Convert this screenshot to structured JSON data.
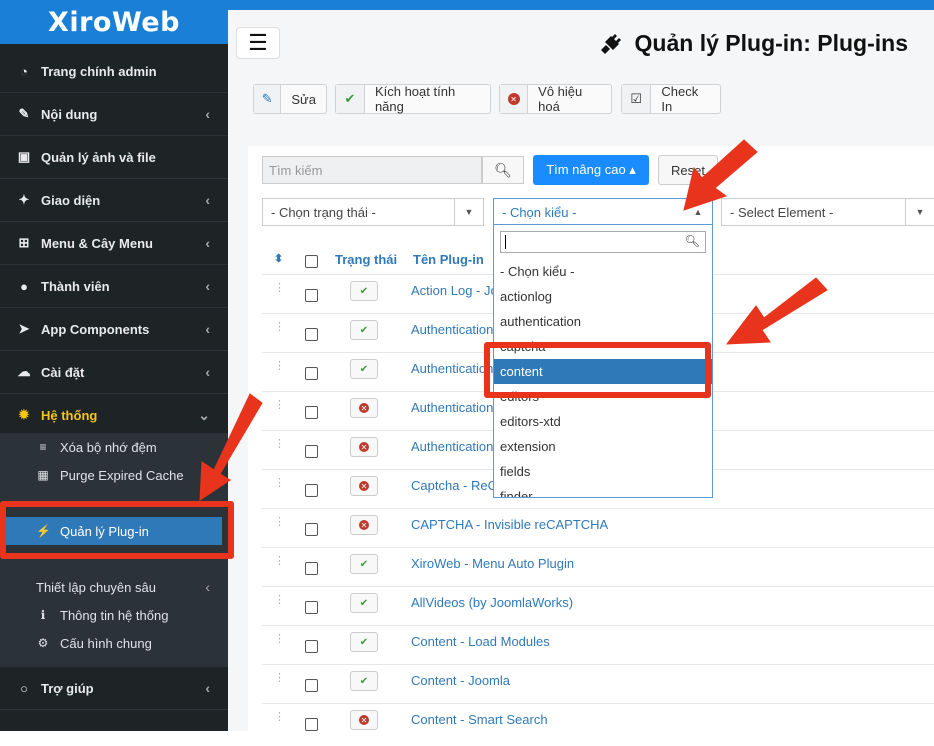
{
  "brand": {
    "logo_text": "XiroWeb",
    "accent": "#1a7fd6"
  },
  "sidebar": {
    "items": [
      {
        "label": "Trang chính admin",
        "icon": "dashboard-icon",
        "has_chevron": false
      },
      {
        "label": "Nội dung",
        "icon": "edit-icon",
        "has_chevron": true
      },
      {
        "label": "Quản lý ảnh và file",
        "icon": "image-icon",
        "has_chevron": false
      },
      {
        "label": "Giao diện",
        "icon": "magic-wand-icon",
        "has_chevron": true
      },
      {
        "label": "Menu & Cây Menu",
        "icon": "sitemap-icon",
        "has_chevron": true
      },
      {
        "label": "Thành viên",
        "icon": "user-icon",
        "has_chevron": true
      },
      {
        "label": "App Components",
        "icon": "rocket-icon",
        "has_chevron": true
      },
      {
        "label": "Cài đặt",
        "icon": "cloud-download-icon",
        "has_chevron": true
      },
      {
        "label": "Hệ thống",
        "icon": "gear-icon",
        "has_chevron": true,
        "active": true
      },
      {
        "label": "Trợ giúp",
        "icon": "circle-icon",
        "has_chevron": true
      }
    ],
    "submenu": [
      {
        "label": "Xóa bộ nhớ đệm",
        "icon": "database-icon"
      },
      {
        "label": "Purge Expired Cache",
        "icon": "calendar-x-icon"
      },
      {
        "label": "Quản lý Plug-in",
        "icon": "plug-icon",
        "active": true
      },
      {
        "label": "Thiết lập chuyên sâu",
        "icon": "",
        "has_chevron": true
      },
      {
        "label": "Thông tin hệ thống",
        "icon": "info-icon"
      },
      {
        "label": "Cấu hình chung",
        "icon": "cogs-icon"
      }
    ]
  },
  "header": {
    "title": "Quản lý Plug-in: Plug-ins",
    "icon": "plug-icon"
  },
  "toolbar": {
    "edit_label": "Sửa",
    "enable_label": "Kích hoạt tính năng",
    "disable_label": "Vô hiệu hoá",
    "checkin_label": "Check In"
  },
  "filters": {
    "search_placeholder": "Tìm kiếm",
    "advanced_label": "Tìm nâng cao ▴",
    "reset_label": "Reset",
    "status_select": "- Chọn trạng thái -",
    "type_select": "- Chọn kiểu -",
    "element_select": "- Select Element -"
  },
  "table": {
    "col_status": "Trạng thái",
    "col_name": "Tên Plug-in",
    "rows": [
      {
        "enabled": true,
        "name": "Action Log - Joomla"
      },
      {
        "enabled": true,
        "name": "Authentication - Cookie"
      },
      {
        "enabled": true,
        "name": "Authentication - Joomla"
      },
      {
        "enabled": false,
        "name": "Authentication - LDAP"
      },
      {
        "enabled": false,
        "name": "Authentication - GMail"
      },
      {
        "enabled": false,
        "name": "Captcha - ReCaptcha"
      },
      {
        "enabled": false,
        "name": "CAPTCHA - Invisible reCAPTCHA"
      },
      {
        "enabled": true,
        "name": "XiroWeb - Menu Auto Plugin"
      },
      {
        "enabled": true,
        "name": "AllVideos (by JoomlaWorks)"
      },
      {
        "enabled": true,
        "name": "Content - Load Modules"
      },
      {
        "enabled": true,
        "name": "Content - Joomla"
      },
      {
        "enabled": false,
        "name": "Content - Smart Search"
      }
    ]
  },
  "type_dropdown": {
    "options": [
      "- Chọn kiểu -",
      "actionlog",
      "authentication",
      "captcha",
      "content",
      "editors",
      "editors-xtd",
      "extension",
      "fields",
      "finder"
    ],
    "selected": "content"
  }
}
